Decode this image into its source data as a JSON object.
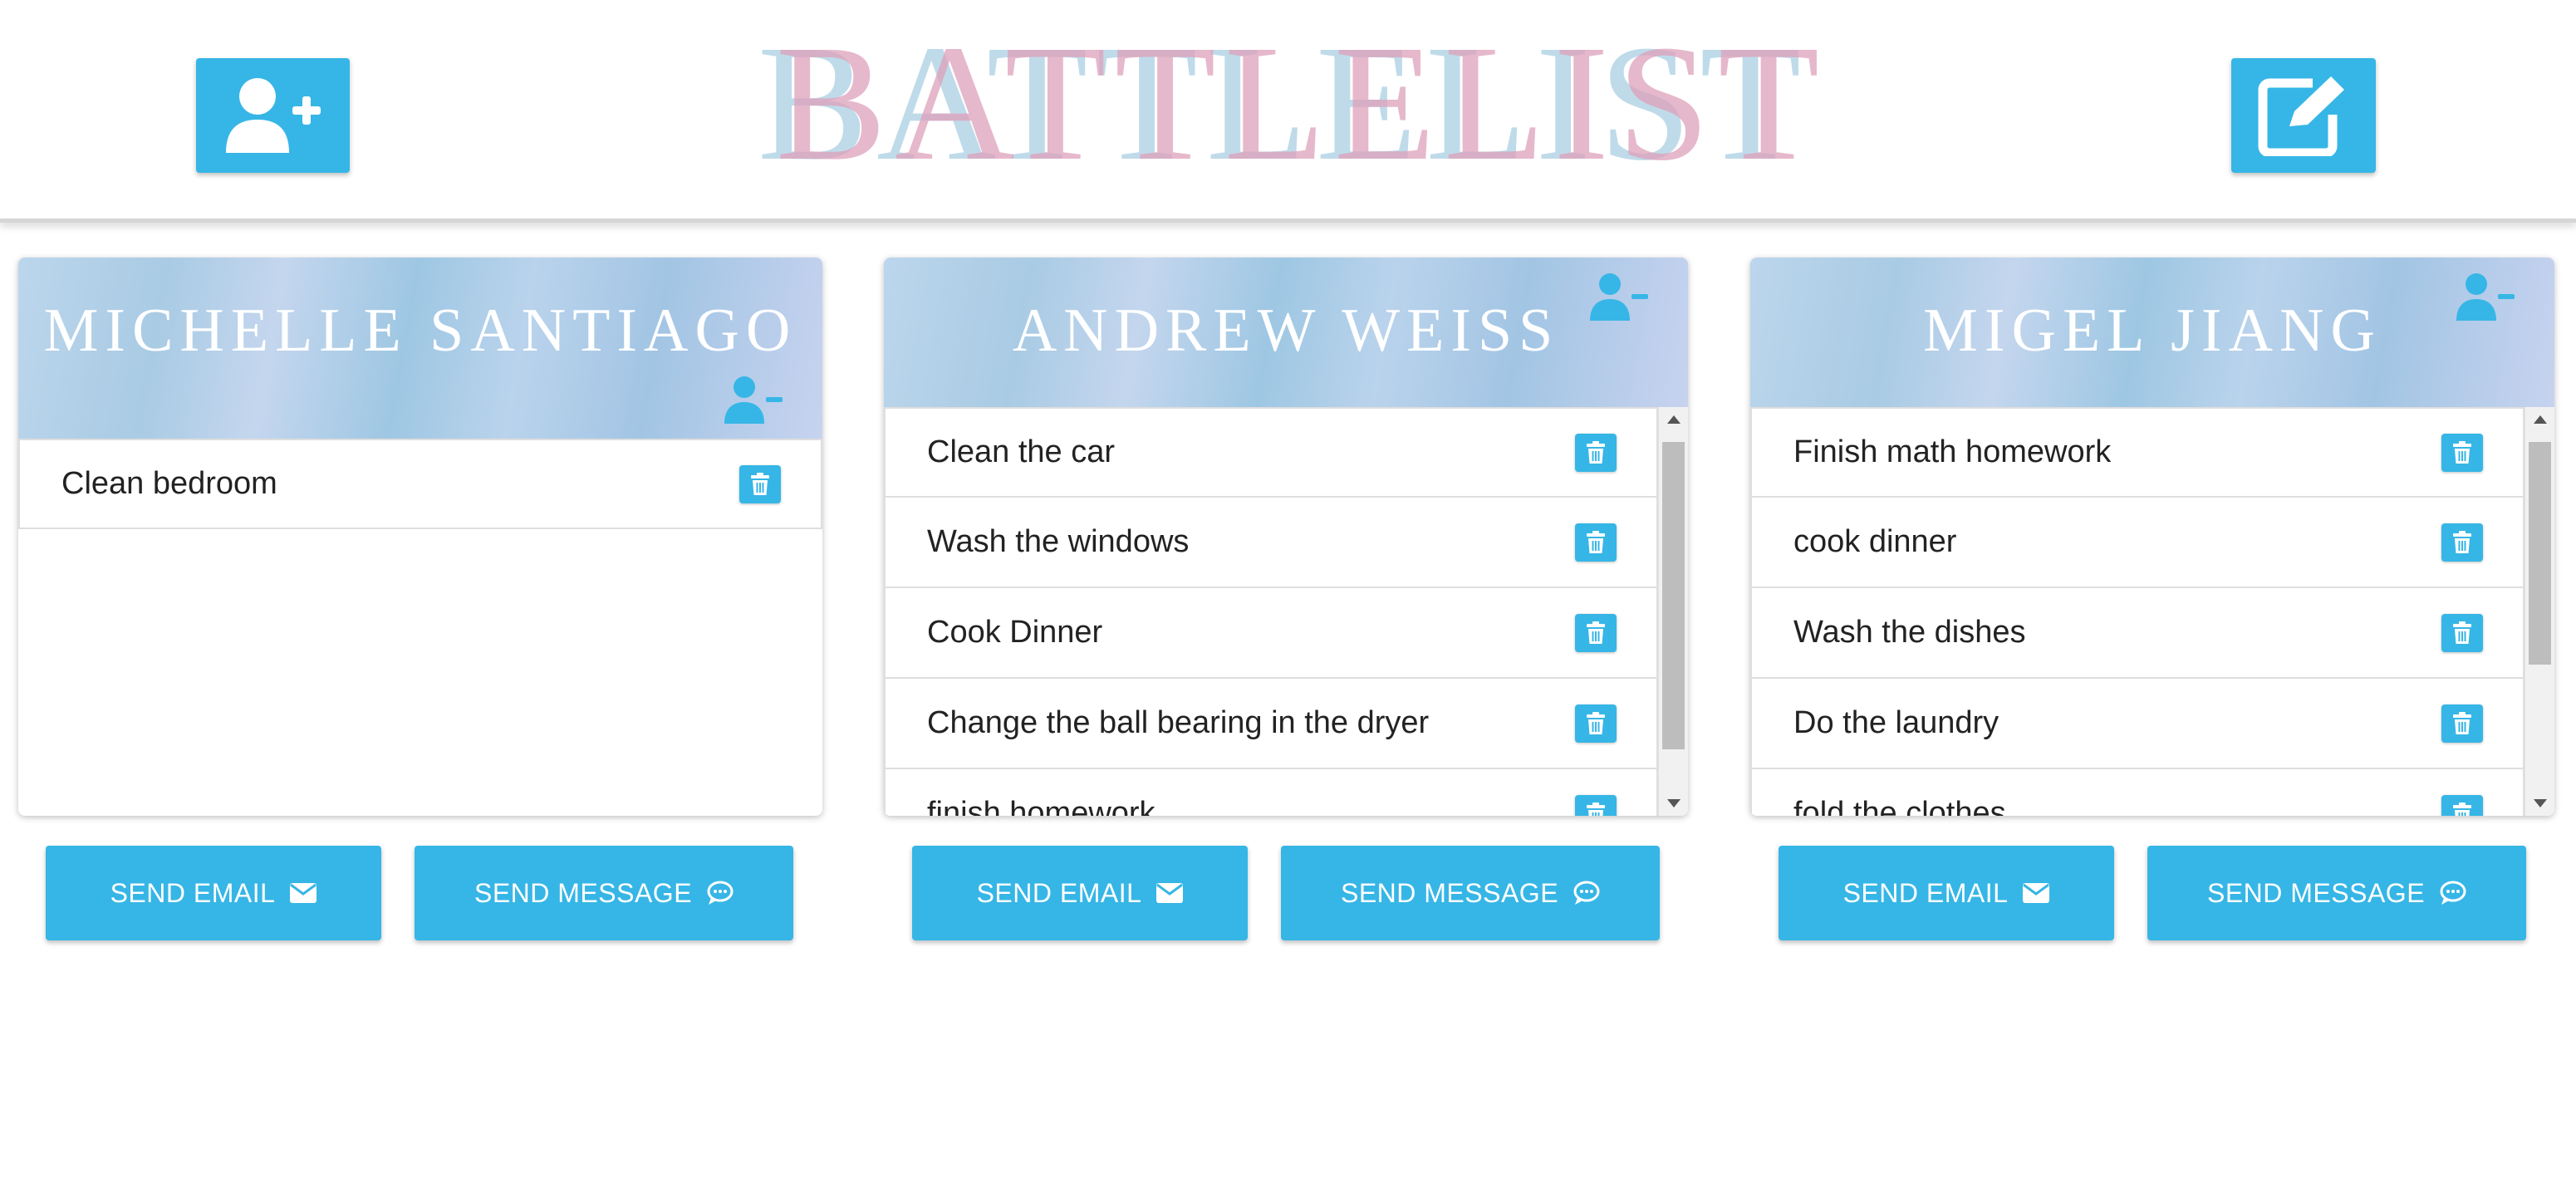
{
  "header": {
    "logo_text": "BATTLELIST",
    "add_icon": "user-plus-icon",
    "edit_icon": "edit-icon"
  },
  "colors": {
    "accent": "#36b6e6",
    "logo_pink": "#dea0ba",
    "logo_blue": "#9cc8de"
  },
  "members": [
    {
      "name": "MICHELLE SANTIAGO",
      "tasks": [
        "Clean bedroom"
      ]
    },
    {
      "name": "ANDREW WEISS",
      "tasks": [
        "Clean the car",
        "Wash the windows",
        "Cook Dinner",
        "Change the ball bearing in the dryer",
        "finish homework"
      ]
    },
    {
      "name": "MIGEL JIANG",
      "tasks": [
        "Finish math homework",
        "cook dinner",
        "Wash the dishes",
        "Do the laundry",
        "fold the clothes"
      ]
    }
  ],
  "actions": {
    "send_email": "SEND EMAIL",
    "send_message": "SEND MESSAGE"
  }
}
